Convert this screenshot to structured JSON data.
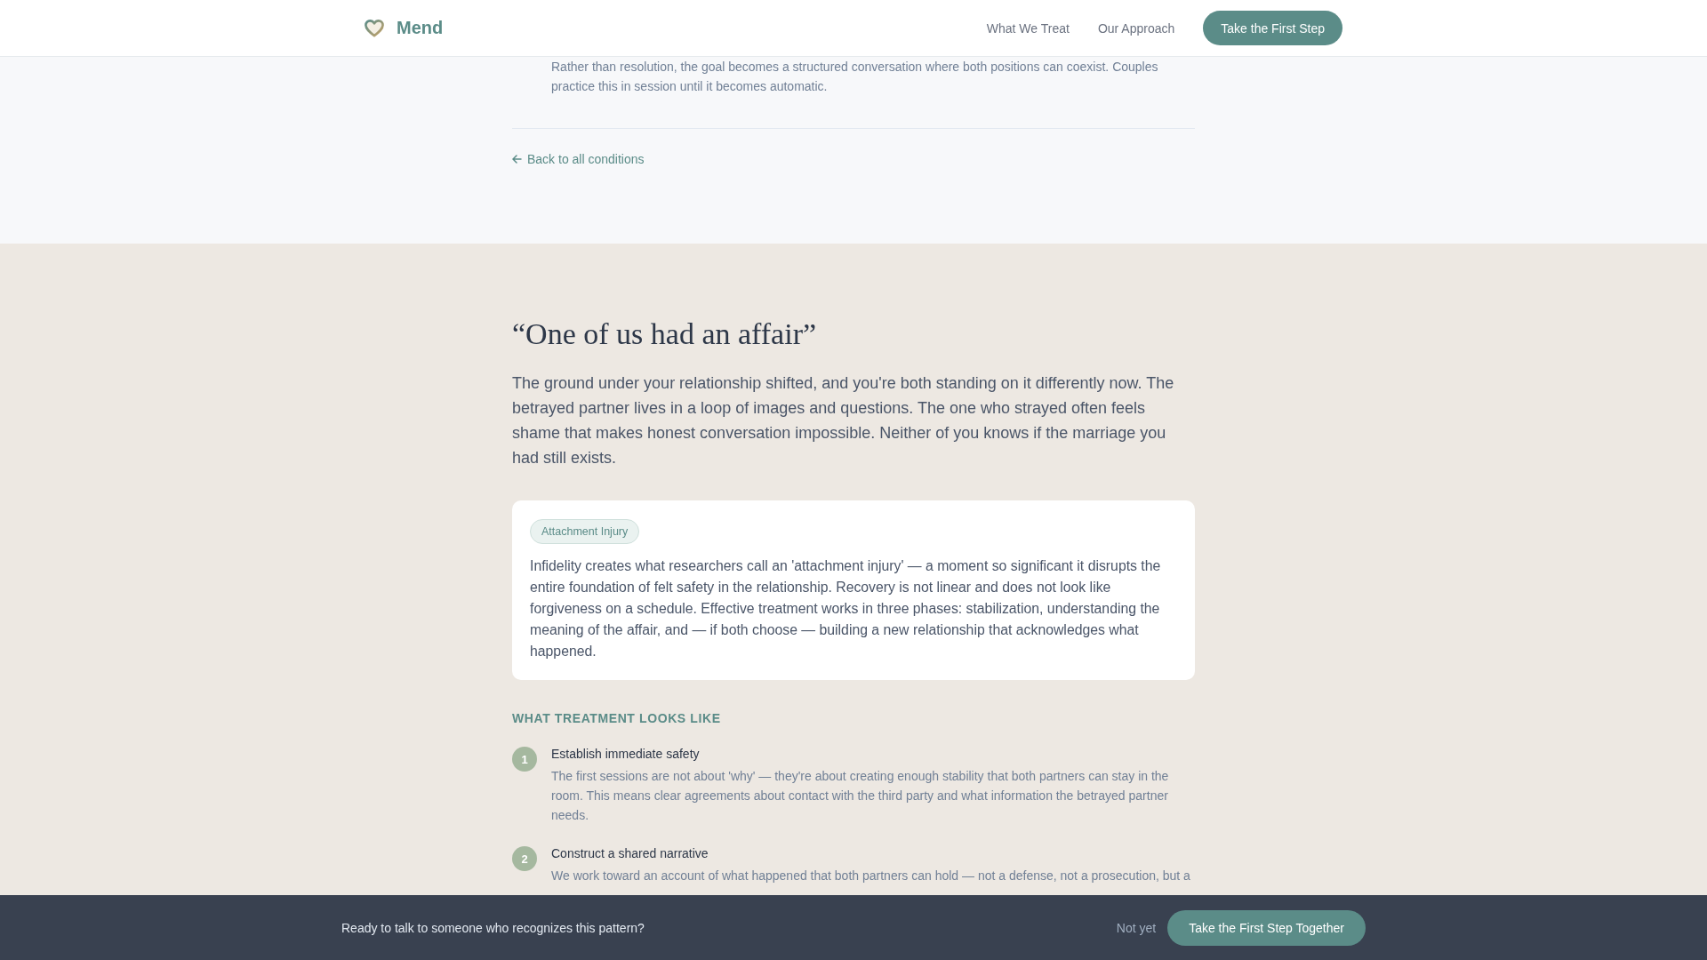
{
  "header": {
    "logo": "Mend",
    "nav": [
      {
        "label": "What We Treat"
      },
      {
        "label": "Our Approach"
      }
    ],
    "button": "Take the First Step"
  },
  "previous_step": {
    "description": "Rather than resolution, the goal becomes a structured conversation where both positions can coexist. Couples practice this in session until it becomes automatic."
  },
  "back_link": "Back to all conditions",
  "condition": {
    "title": "“One of us had an affair”",
    "intro": "The ground under your relationship shifted, and you're both standing on it differently now. The betrayed partner lives in a loop of images and questions. The one who strayed often feels shame that makes honest conversation impossible. Neither of you knows if the marriage you had still exists.",
    "card": {
      "tag": "Attachment Injury",
      "text": "Infidelity creates what researchers call an 'attachment injury' — a moment so significant it disrupts the entire foundation of felt safety in the relationship. Recovery is not linear and does not look like forgiveness on a schedule. Effective treatment works in three phases: stabilization, understanding the meaning of the affair, and — if both choose — building a new relationship that acknowledges what happened."
    },
    "treatment": {
      "heading": "WHAT TREATMENT LOOKS LIKE",
      "steps": [
        {
          "number": "1",
          "title": "Establish immediate safety",
          "description": "The first sessions are not about 'why' — they're about creating enough stability that both partners can stay in the room. This means clear agreements about contact with the third party and what information the betrayed partner needs."
        },
        {
          "number": "2",
          "title": "Construct a shared narrative",
          "description": "We work toward an account of what happened that both partners can hold — not a defense, not a prosecution, but a"
        }
      ]
    }
  },
  "cta_bar": {
    "text": "Ready to talk to someone who recognizes this pattern?",
    "dismiss": "Not yet",
    "button": "Take the First Step Together"
  }
}
